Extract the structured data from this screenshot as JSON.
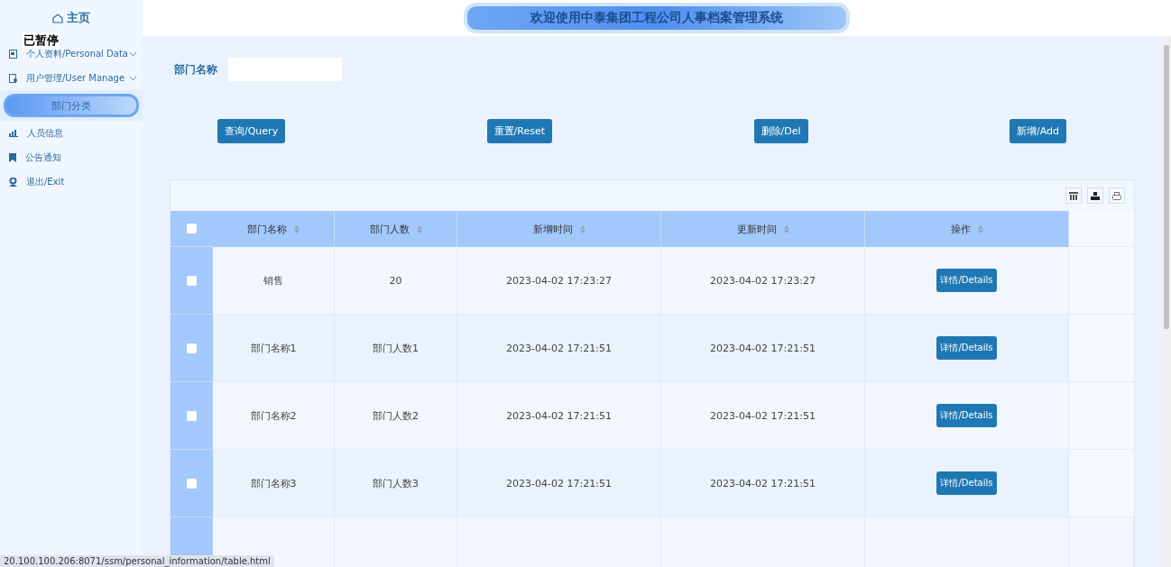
{
  "sidebar": {
    "home": "主页",
    "items": [
      {
        "label": "个人资料/Personal Data",
        "kind": "doc",
        "expandable": true,
        "selected": false
      },
      {
        "label": "用户管理/User Manage",
        "kind": "clipboard",
        "expandable": true,
        "selected": false
      },
      {
        "label": "部门分类",
        "kind": "plain",
        "selected": true
      },
      {
        "label": "人员信息",
        "kind": "chart",
        "selected": false
      },
      {
        "label": "公告通知",
        "kind": "bookmark",
        "selected": false
      },
      {
        "label": "退出/Exit",
        "kind": "user",
        "selected": false
      }
    ]
  },
  "overlay_label": "已暂停",
  "header": {
    "title": "欢迎使用中泰集团工程公司人事档案管理系统"
  },
  "search": {
    "label": "部门名称"
  },
  "buttons": [
    "查询/Query",
    "重置/Reset",
    "删除/Del",
    "新增/Add"
  ],
  "table": {
    "all_checked": false,
    "columns": [
      "部门名称",
      "部门人数",
      "新增时间",
      "更新时间",
      "操作"
    ],
    "rows": [
      {
        "checked": false,
        "cells": [
          "销售",
          "20",
          "2023-04-02 17:23:27",
          "2023-04-02 17:23:27"
        ],
        "action": "详情/Details"
      },
      {
        "checked": false,
        "cells": [
          "部门名称1",
          "部门人数1",
          "2023-04-02 17:21:51",
          "2023-04-02 17:21:51"
        ],
        "action": "详情/Details"
      },
      {
        "checked": false,
        "cells": [
          "部门名称2",
          "部门人数2",
          "2023-04-02 17:21:51",
          "2023-04-02 17:21:51"
        ],
        "action": "详情/Details"
      },
      {
        "checked": false,
        "cells": [
          "部门名称3",
          "部门人数3",
          "2023-04-02 17:21:51",
          "2023-04-02 17:21:51"
        ],
        "action": "详情/Details"
      }
    ]
  },
  "status_url": "20.100.100.206:8071/ssm/personal_information/table.html"
}
